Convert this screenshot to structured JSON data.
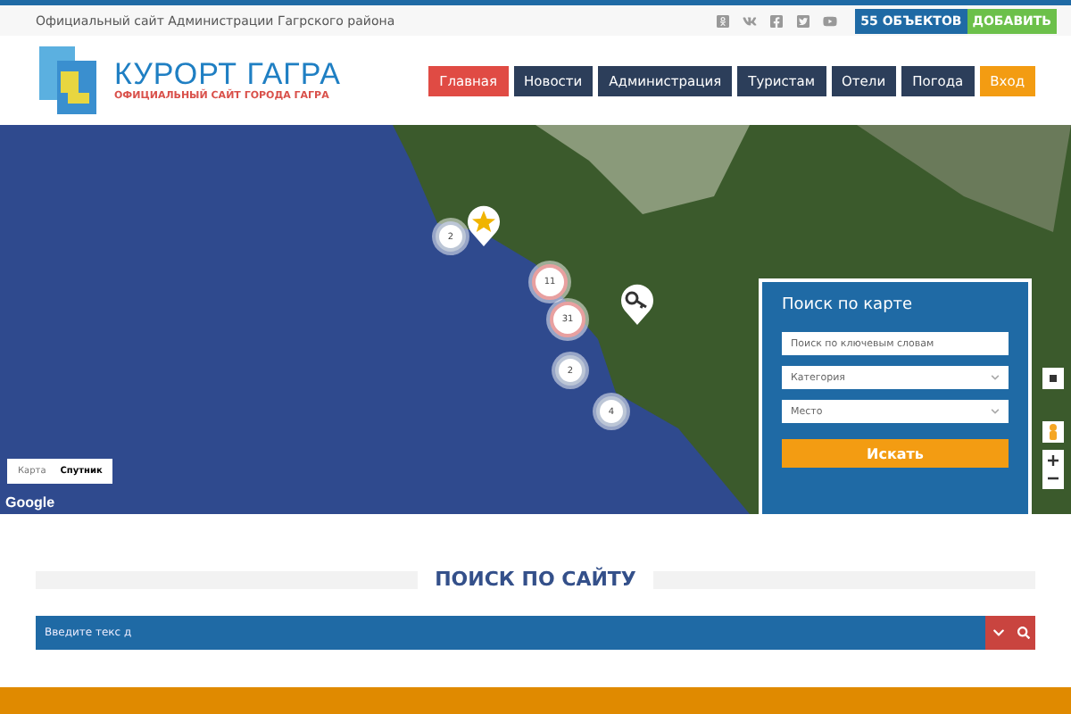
{
  "top_bar": {
    "tagline": "Официальный сайт Администрации Гагрского района",
    "objects_count": "55 ОБЪЕКТОВ",
    "add_button": "ДОБАВИТЬ"
  },
  "header": {
    "logo_title": "КУРОРТ ГАГРА",
    "logo_subtitle": "ОФИЦИАЛЬНЫЙ САЙТ ГОРОДА ГАГРА"
  },
  "nav": [
    {
      "label": "Главная",
      "kind": "page",
      "selected": true
    },
    {
      "label": "Новости",
      "kind": "page",
      "selected": false
    },
    {
      "label": "Администрация",
      "kind": "page",
      "selected": false
    },
    {
      "label": "Туристам",
      "kind": "page",
      "selected": false
    },
    {
      "label": "Отели",
      "kind": "page",
      "selected": false
    },
    {
      "label": "Погода",
      "kind": "page",
      "selected": false
    },
    {
      "label": "Вход",
      "kind": "login",
      "selected": false
    }
  ],
  "map": {
    "markers": [
      {
        "kind": "cluster",
        "count": "2"
      },
      {
        "kind": "star"
      },
      {
        "kind": "cluster",
        "count": "11"
      },
      {
        "kind": "cluster",
        "count": "31"
      },
      {
        "kind": "key"
      },
      {
        "kind": "cluster",
        "count": "2"
      },
      {
        "kind": "cluster",
        "count": "4"
      }
    ],
    "map_types": [
      {
        "label": "Карта",
        "selected": false
      },
      {
        "label": "Спутник",
        "selected": true
      }
    ],
    "attribution": "Google",
    "search_panel": {
      "title": "Поиск по карте",
      "keyword_placeholder": "Поиск по ключевым словам",
      "category": "Категория",
      "place": "Место",
      "button": "Искать"
    }
  },
  "site_search": {
    "title": "ПОИСК ПО САЙТУ",
    "placeholder": "Введите текс д"
  }
}
